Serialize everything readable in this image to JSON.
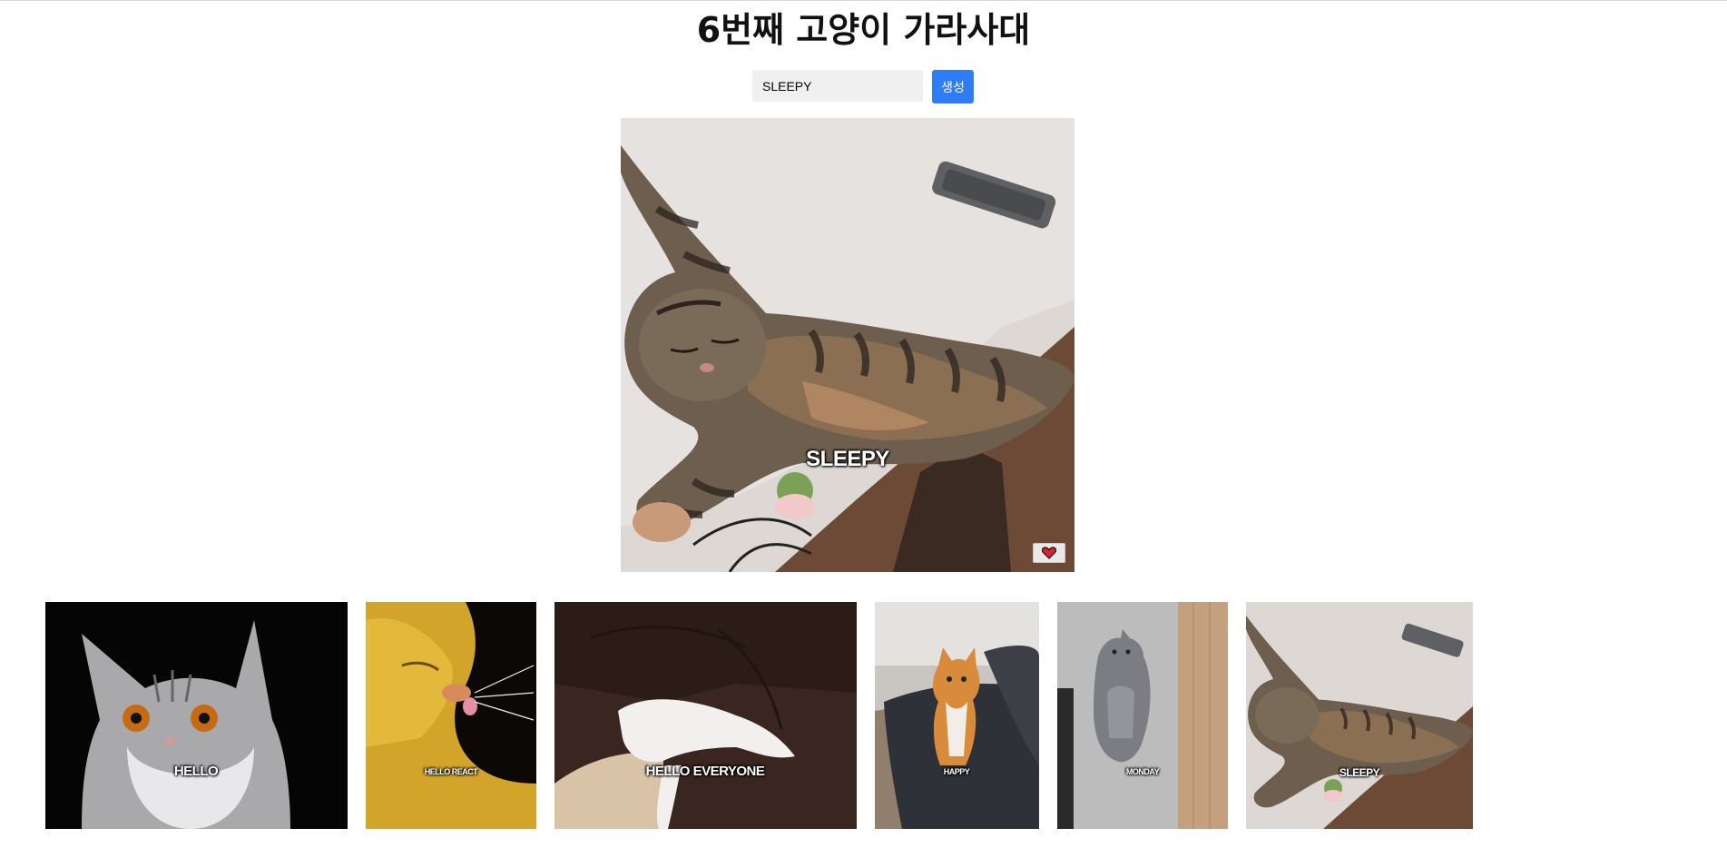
{
  "page": {
    "title": "6번째 고양이 가라사대"
  },
  "form": {
    "input_value": "SLEEPY",
    "create_label": "생성"
  },
  "main": {
    "caption": "SLEEPY",
    "like_icon": "heart-icon"
  },
  "gallery": [
    {
      "caption": "HELLO",
      "desc": "grey white cat on black"
    },
    {
      "caption": "HELLO REACT",
      "desc": "orange cat licking"
    },
    {
      "caption": "HELLO EVERYONE",
      "desc": "white cat on brown sofa"
    },
    {
      "caption": "HAPPY",
      "desc": "orange cat standing on chair"
    },
    {
      "caption": "MONDAY",
      "desc": "grey cat lying on floor"
    },
    {
      "caption": "SLEEPY",
      "desc": "tabby cat sleeping"
    }
  ],
  "colors": {
    "accent": "#2f7df6",
    "input_bg": "#f0f0f0",
    "heart": "#e0202a"
  }
}
